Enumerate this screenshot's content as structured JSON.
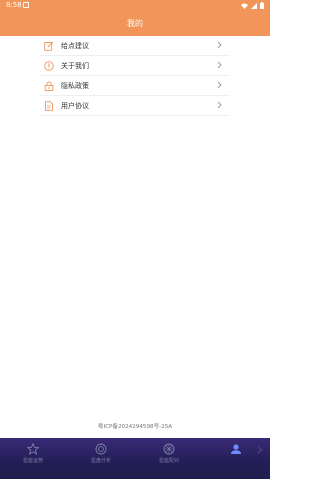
{
  "status_bar": {
    "time": "8:58"
  },
  "header": {
    "title": "我的"
  },
  "menu": {
    "items": [
      {
        "label": "给点建议",
        "icon": "edit-icon"
      },
      {
        "label": "关于我们",
        "icon": "info-icon"
      },
      {
        "label": "隐私政策",
        "icon": "lock-icon"
      },
      {
        "label": "用户协议",
        "icon": "document-icon"
      }
    ]
  },
  "footer": {
    "icp": "粤ICP备2024294598号-25A"
  },
  "tabs": [
    {
      "label": "星座运势",
      "icon": "star-icon",
      "active": false
    },
    {
      "label": "星盘分析",
      "icon": "circle-icon",
      "active": false
    },
    {
      "label": "星座配对",
      "icon": "wheel-icon",
      "active": false
    },
    {
      "label": "",
      "icon": "user-icon",
      "active": true
    }
  ],
  "colors": {
    "accent": "#f2955a",
    "tab_bg": "#221e55",
    "tab_active": "#6c8cff"
  }
}
